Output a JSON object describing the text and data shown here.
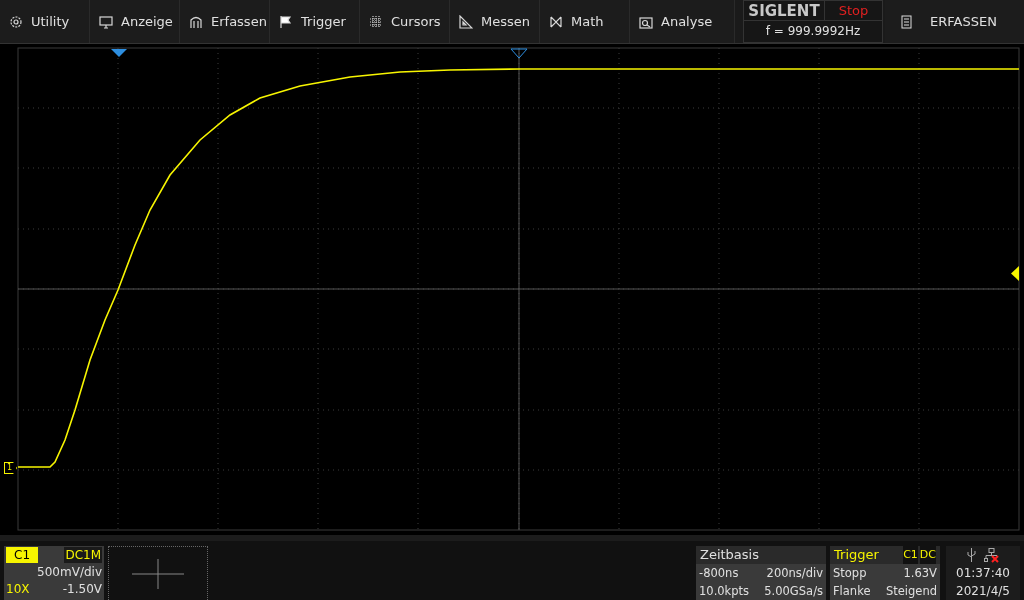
{
  "menu": [
    {
      "label": "Utility"
    },
    {
      "label": "Anzeige"
    },
    {
      "label": "Erfassen"
    },
    {
      "label": "Trigger"
    },
    {
      "label": "Cursors"
    },
    {
      "label": "Messen"
    },
    {
      "label": "Math"
    },
    {
      "label": "Analyse"
    }
  ],
  "brand": {
    "logo": "SIGLENT",
    "run_state": "Stop",
    "frequency": "f = 999.9992Hz"
  },
  "mode_button": {
    "label": "ERFASSEN"
  },
  "plot": {
    "channel_marker": "1"
  },
  "channel": {
    "name": "C1",
    "coupling": "DC1M",
    "scale": "500mV/div",
    "probe": "10X",
    "offset": "-1.50V"
  },
  "timebase": {
    "title": "Zeitbasis",
    "delay": "-800ns",
    "scale": "200ns/div",
    "points": "10.0kpts",
    "sample_rate": "5.00GSa/s"
  },
  "trigger": {
    "title": "Trigger",
    "source": "C1",
    "coupling": "DC",
    "state": "Stopp",
    "level": "1.63V",
    "type": "Flanke",
    "slope": "Steigend"
  },
  "status": {
    "time": "01:37:40",
    "date": "2021/4/5"
  }
}
